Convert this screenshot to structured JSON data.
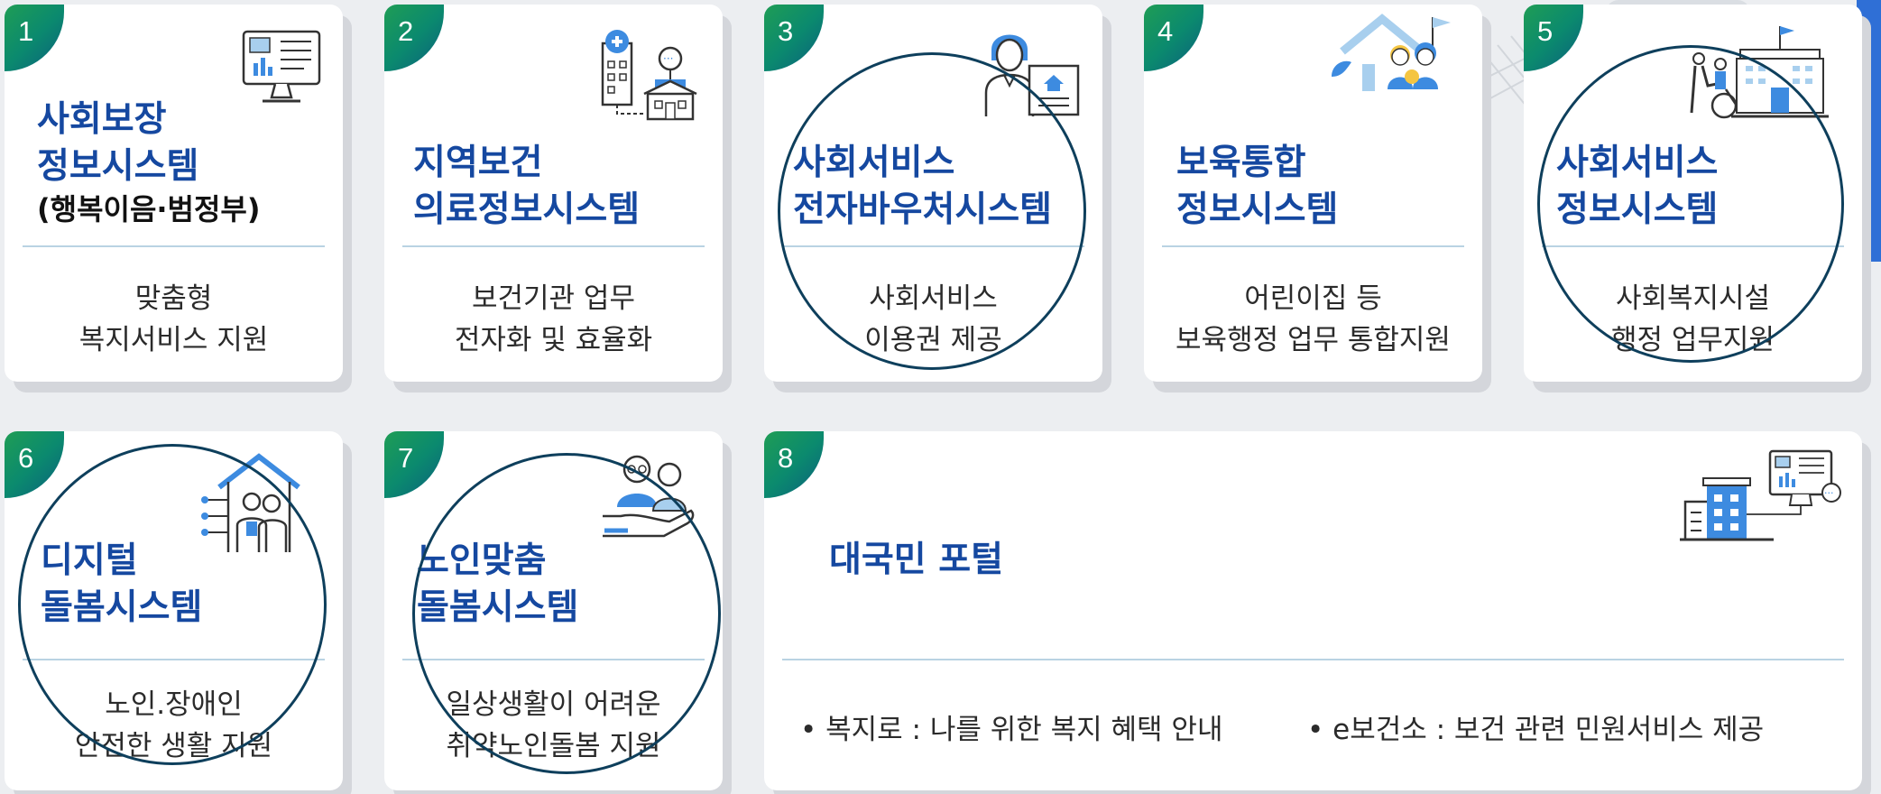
{
  "cards": [
    {
      "number": "1",
      "title": [
        "사회보장",
        "정보시스템"
      ],
      "subtitle": "(행복이음·범정부)",
      "description": [
        "맞춤형",
        "복지서비스 지원"
      ],
      "icon": "monitor-dashboard-icon"
    },
    {
      "number": "2",
      "title": [
        "지역보건",
        "의료정보시스템"
      ],
      "description": [
        "보건기관 업무",
        "전자화 및 효율화"
      ],
      "icon": "hospital-building-icon"
    },
    {
      "number": "3",
      "title": [
        "사회서비스",
        "전자바우처시스템"
      ],
      "description": [
        "사회서비스",
        "이용권 제공"
      ],
      "icon": "person-voucher-icon"
    },
    {
      "number": "4",
      "title": [
        "보육통합",
        "정보시스템"
      ],
      "description": [
        "어린이집 등",
        "보육행정 업무 통합지원"
      ],
      "icon": "childcare-house-icon"
    },
    {
      "number": "5",
      "title": [
        "사회서비스",
        "정보시스템"
      ],
      "description": [
        "사회복지시설",
        "행정 업무지원"
      ],
      "icon": "welfare-facility-icon"
    },
    {
      "number": "6",
      "title": [
        "디지털",
        "돌봄시스템"
      ],
      "description": [
        "노인.장애인",
        "안전한 생활 지원"
      ],
      "icon": "digital-care-house-icon"
    },
    {
      "number": "7",
      "title": [
        "노인맞춤",
        "돌봄시스템"
      ],
      "description": [
        "일상생활이 어려운",
        "취약노인돌봄 지원"
      ],
      "icon": "elderly-care-hand-icon"
    },
    {
      "number": "8",
      "title": [
        "대국민 포털"
      ],
      "bullets": [
        "• 복지로 : 나를 위한 복지 혜택 안내",
        "• e보건소 : 보건 관련 민원서비스 제공"
      ],
      "icon": "building-monitor-icon"
    }
  ],
  "colors": {
    "title": "#1548a0",
    "accent_blue": "#3d8be0",
    "badge_green": "#1f9d55",
    "circle": "#0e3f5c",
    "divider": "#b9d3e3"
  }
}
